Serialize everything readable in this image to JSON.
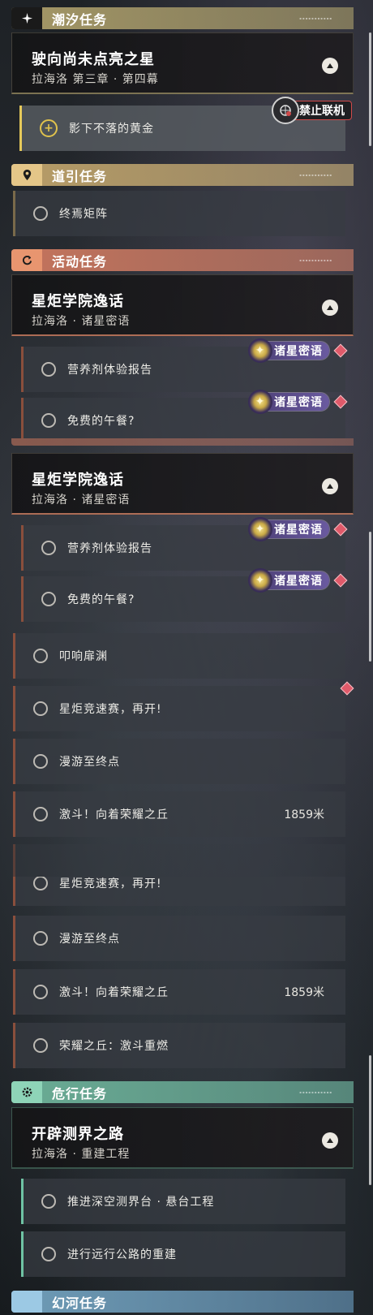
{
  "panel1": {
    "tide": {
      "category": "潮汐任务",
      "quest_title": "驶向尚未点亮之星",
      "quest_subtitle": "拉海洛 第三章 · 第四幕",
      "online_status": "禁止联机",
      "objective": "影下不落的黄金"
    },
    "guide": {
      "category": "道引任务",
      "items": [
        "终焉矩阵"
      ]
    },
    "activity": {
      "category": "活动任务",
      "quest_title": "星炬学院逸话",
      "quest_subtitle": "拉海洛 · 诸星密语",
      "badge": "诸星密语",
      "items": [
        "营养剂体验报告",
        "免费的午餐?"
      ]
    }
  },
  "panel2": {
    "quest_title": "星炬学院逸话",
    "quest_subtitle": "拉海洛 · 诸星密语",
    "badge": "诸星密语",
    "sub_items": [
      "营养剂体验报告",
      "免费的午餐?"
    ],
    "items": [
      "叩响扉渊",
      "星炬竞速赛，再开!",
      "漫游至终点",
      "激斗！向着荣耀之丘"
    ],
    "distance": "1859米"
  },
  "panel3": {
    "items": [
      "星炬竞速赛，再开!",
      "漫游至终点",
      "激斗！向着荣耀之丘",
      "荣耀之丘：激斗重燃"
    ],
    "distance": "1859米",
    "danger": {
      "category": "危行任务",
      "quest_title": "开辟测界之路",
      "quest_subtitle": "拉海洛 · 重建工程",
      "items": [
        "推进深空测界台 · 悬台工程",
        "进行远行公路的重建"
      ]
    },
    "next_category": "幻河任务"
  },
  "colors": {
    "tide": "#b4a56e",
    "guide": "#c8aa6e",
    "activity": "#cd785f",
    "danger": "#6eb49b",
    "badge": "#5a4a8c",
    "alert": "#e05a6a"
  },
  "icons": [
    "sparkle-icon",
    "location-pin-icon",
    "refresh-icon",
    "gear-icon",
    "chevron-up-icon",
    "radio-circle-icon",
    "plus-circle-icon",
    "star-badge-icon",
    "diamond-alert-icon",
    "network-off-icon"
  ]
}
